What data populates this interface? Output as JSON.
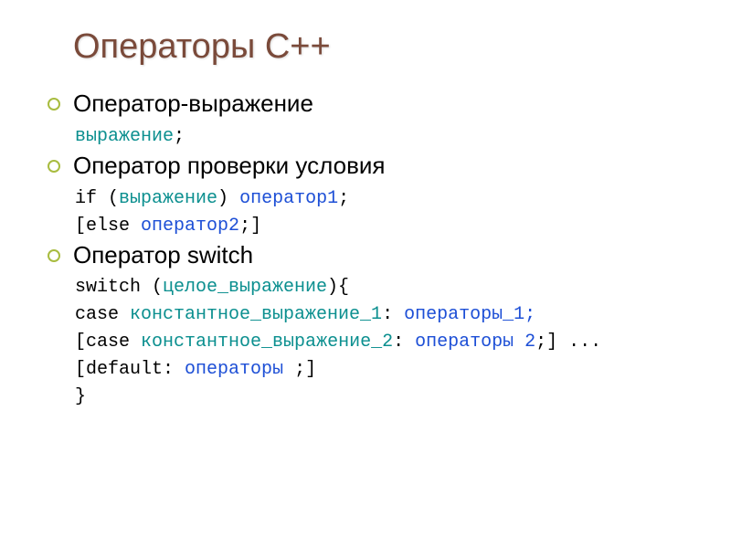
{
  "title": "Операторы С++",
  "sections": [
    {
      "heading": "Оператор-выражение",
      "lines": [
        {
          "segments": [
            {
              "text": "выражение",
              "cls": "kw-teal"
            },
            {
              "text": ";",
              "cls": ""
            }
          ]
        }
      ]
    },
    {
      "heading": "Оператор проверки условия",
      "lines": [
        {
          "segments": [
            {
              "text": "if (",
              "cls": ""
            },
            {
              "text": "выражение",
              "cls": "kw-teal"
            },
            {
              "text": ") ",
              "cls": ""
            },
            {
              "text": "оператор1",
              "cls": "kw-blue"
            },
            {
              "text": ";",
              "cls": ""
            }
          ]
        },
        {
          "segments": [
            {
              "text": "[",
              "cls": "sq"
            },
            {
              "text": "else ",
              "cls": ""
            },
            {
              "text": "оператор2",
              "cls": "kw-blue"
            },
            {
              "text": ";",
              "cls": ""
            },
            {
              "text": "]",
              "cls": "sq"
            }
          ]
        }
      ]
    },
    {
      "heading": "Оператор switch",
      "lines": [
        {
          "segments": [
            {
              "text": "switch (",
              "cls": ""
            },
            {
              "text": "целое_выражение",
              "cls": "kw-teal"
            },
            {
              "text": "){",
              "cls": ""
            }
          ]
        },
        {
          "segments": [
            {
              "text": "case ",
              "cls": ""
            },
            {
              "text": "константное_выражение_1",
              "cls": "kw-teal"
            },
            {
              "text": ": ",
              "cls": ""
            },
            {
              "text": "операторы_1;",
              "cls": "kw-blue"
            }
          ]
        },
        {
          "segments": [
            {
              "text": "[",
              "cls": "sq"
            },
            {
              "text": "case ",
              "cls": ""
            },
            {
              "text": "константное_выражение_2",
              "cls": "kw-teal"
            },
            {
              "text": ": ",
              "cls": ""
            },
            {
              "text": "операторы 2",
              "cls": "kw-blue"
            },
            {
              "text": ";",
              "cls": ""
            },
            {
              "text": "]",
              "cls": "sq"
            },
            {
              "text": " ...",
              "cls": ""
            }
          ]
        },
        {
          "segments": [
            {
              "text": "[",
              "cls": "sq"
            },
            {
              "text": "default: ",
              "cls": ""
            },
            {
              "text": "операторы ",
              "cls": "kw-blue"
            },
            {
              "text": ";",
              "cls": ""
            },
            {
              "text": "]",
              "cls": "sq"
            }
          ]
        },
        {
          "segments": [
            {
              "text": "}",
              "cls": ""
            }
          ]
        }
      ]
    }
  ]
}
